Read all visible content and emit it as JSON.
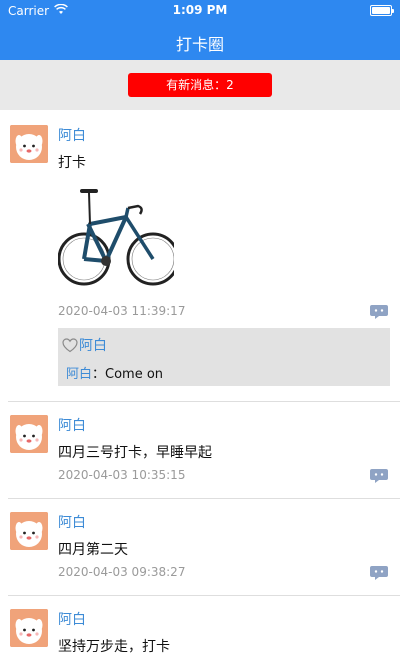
{
  "status_bar": {
    "carrier": "Carrier",
    "time": "1:09 PM"
  },
  "nav": {
    "title": "打卡圈"
  },
  "notice": {
    "label": "有新消息：2"
  },
  "posts": [
    {
      "author": "阿白",
      "content": "打卡",
      "time": "2020-04-03 11:39:17",
      "likes_label": "阿白",
      "comment": {
        "author": "阿白",
        "separator": "：",
        "text": "Come on"
      }
    },
    {
      "author": "阿白",
      "content": "四月三号打卡，早睡早起",
      "time": "2020-04-03 10:35:15"
    },
    {
      "author": "阿白",
      "content": "四月第二天",
      "time": "2020-04-03 09:38:27"
    },
    {
      "author": "阿白",
      "content": "坚持万步走，打卡"
    }
  ],
  "colors": {
    "accent": "#2e88f0",
    "link": "#3d8bd6",
    "notice": "#ff0000"
  }
}
